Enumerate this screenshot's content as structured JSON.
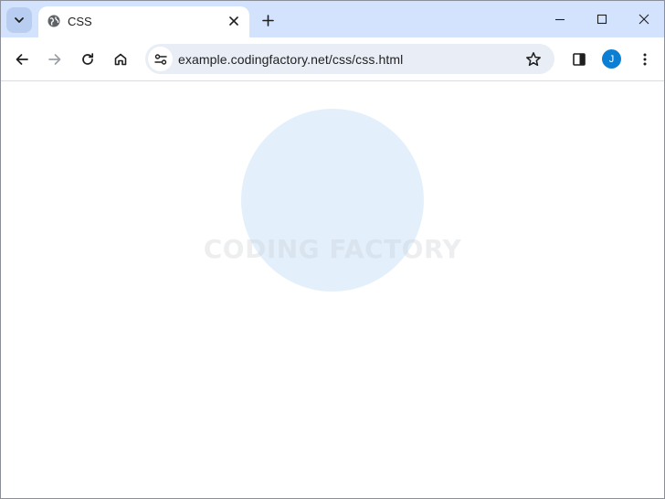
{
  "tab": {
    "title": "CSS",
    "favicon_icon": "globe-icon",
    "close_icon": "close-icon"
  },
  "tabstrip": {
    "search_icon": "chevron-down-icon",
    "new_tab_icon": "plus-icon"
  },
  "window_controls": [
    "minimize-icon",
    "maximize-icon",
    "close-icon"
  ],
  "toolbar": {
    "back_icon": "arrow-left-icon",
    "forward_icon": "arrow-right-icon",
    "reload_icon": "reload-icon",
    "home_icon": "home-icon",
    "site_info_icon": "tune-icon",
    "url": "example.codingfactory.net/css/css.html",
    "bookmark_icon": "star-icon",
    "side_panel_icon": "side-panel-icon",
    "profile_initial": "J",
    "menu_icon": "kebab-menu-icon"
  },
  "page": {
    "watermark": "CODING FACTORY",
    "circle_color": "#e3f0fc"
  },
  "colors": {
    "tabstrip_bg": "#d3e3fd",
    "omnibox_bg": "#e9eef6",
    "avatar_bg": "#0b7fd4"
  }
}
